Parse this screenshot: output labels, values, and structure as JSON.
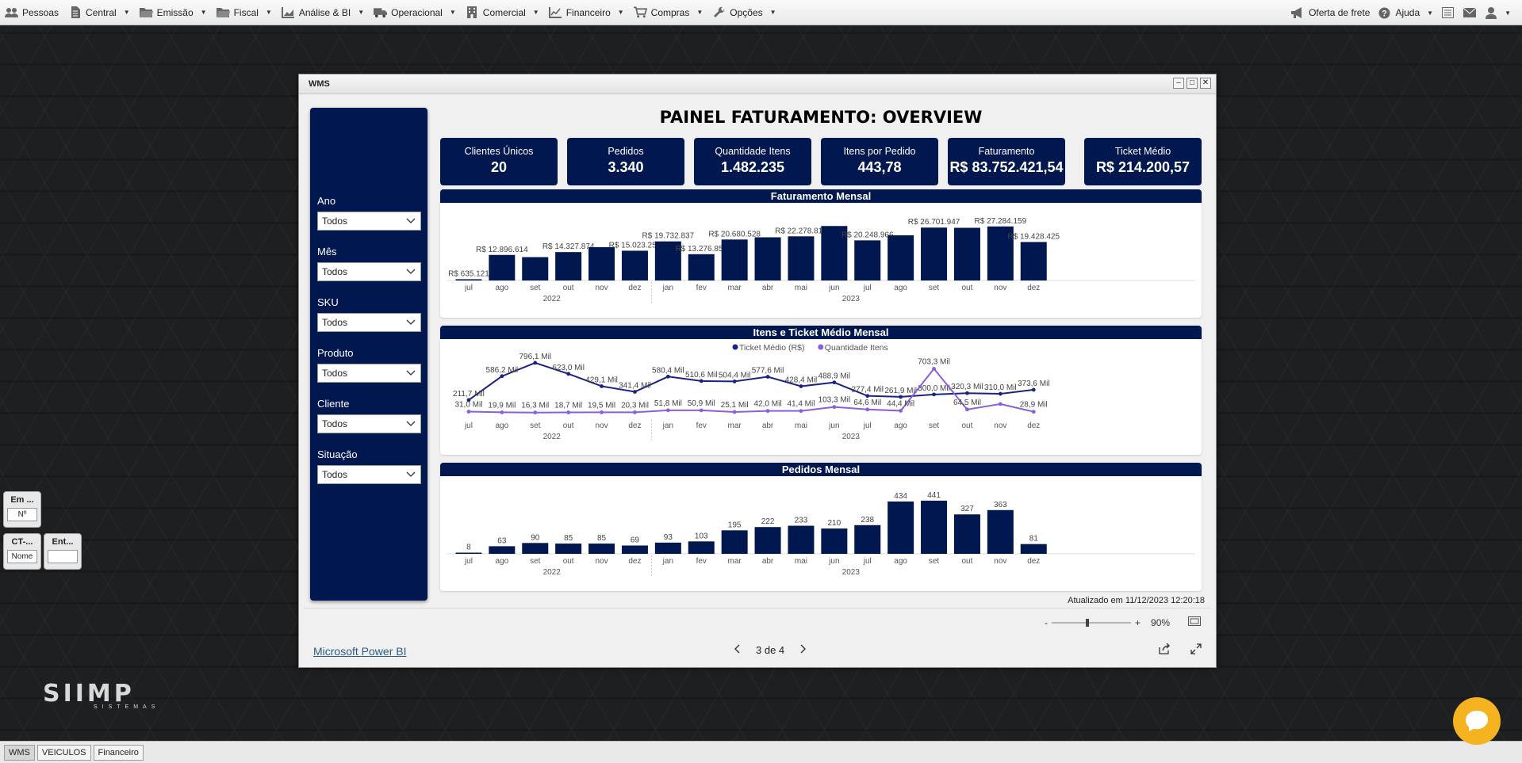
{
  "menu": {
    "items": [
      {
        "label": "Pessoas",
        "icon": "people-icon",
        "caret": false
      },
      {
        "label": "Central",
        "icon": "document-icon",
        "caret": true
      },
      {
        "label": "Emissão",
        "icon": "folder-icon",
        "caret": true
      },
      {
        "label": "Fiscal",
        "icon": "folder-icon",
        "caret": true
      },
      {
        "label": "Análise & BI",
        "icon": "chart-icon",
        "caret": true
      },
      {
        "label": "Operacional",
        "icon": "truck-icon",
        "caret": true
      },
      {
        "label": "Comercial",
        "icon": "building-icon",
        "caret": true
      },
      {
        "label": "Financeiro",
        "icon": "line-chart-icon",
        "caret": true
      },
      {
        "label": "Compras",
        "icon": "cart-icon",
        "caret": true
      },
      {
        "label": "Opções",
        "icon": "wrench-icon",
        "caret": true
      }
    ],
    "right": {
      "freight": "Oferta de frete",
      "help": "Ajuda"
    }
  },
  "side_buttons": {
    "em_title": "Em ...",
    "em_box": "Nº",
    "ct_title": "CT-...",
    "ct_box": "Nome",
    "ent_title": "Ent..."
  },
  "logo": {
    "main": "SIIMP",
    "sub": "SISTEMAS"
  },
  "taskbar": {
    "tabs": [
      "WMS",
      "VEICULOS",
      "Financeiro"
    ]
  },
  "window": {
    "title": "WMS"
  },
  "report": {
    "title": "PAINEL FATURAMENTO: OVERVIEW",
    "cards": [
      {
        "label": "Clientes Únicos",
        "value": "20"
      },
      {
        "label": "Pedidos",
        "value": "3.340"
      },
      {
        "label": "Quantidade Itens",
        "value": "1.482.235"
      },
      {
        "label": "Itens por Pedido",
        "value": "443,78"
      },
      {
        "label": "Faturamento",
        "value": "R$ 83.752.421,54"
      },
      {
        "label": "Ticket Médio",
        "value": "R$ 214.200,57"
      }
    ],
    "slicers": [
      {
        "label": "Ano",
        "value": "Todos"
      },
      {
        "label": "Mês",
        "value": "Todos"
      },
      {
        "label": "SKU",
        "value": "Todos"
      },
      {
        "label": "Produto",
        "value": "Todos"
      },
      {
        "label": "Cliente",
        "value": "Todos"
      },
      {
        "label": "Situação",
        "value": "Todos"
      }
    ],
    "updated": "Atualizado em 11/12/2023 12:20:18",
    "zoom": {
      "minus": "-",
      "plus": "+",
      "value": "90%",
      "level": 0.45
    },
    "footer": {
      "link": "Microsoft Power BI",
      "pages": "3 de 4"
    }
  },
  "chart_data": [
    {
      "type": "bar",
      "title": "Faturamento Mensal",
      "categories": [
        "jul",
        "ago",
        "set",
        "out",
        "nov",
        "dez",
        "jan",
        "fev",
        "mar",
        "abr",
        "mai",
        "jun",
        "jul",
        "ago",
        "set",
        "out",
        "nov",
        "dez"
      ],
      "years": [
        {
          "label": "2022",
          "span": 6
        },
        {
          "label": "2023",
          "span": 12
        }
      ],
      "values": [
        635121,
        12896614,
        11800000,
        14327874,
        16800000,
        15023255,
        19732837,
        13276855,
        20680528,
        21800000,
        22278813,
        27500000,
        20248966,
        22800000,
        26701947,
        26600000,
        27284159,
        19428425
      ],
      "data_labels": [
        "R$ 635.121",
        "R$ 12.896.614",
        "",
        "R$ 14.327.874",
        "",
        "R$ 15.023.255",
        "R$ 19.732.837",
        "R$ 13.276.855",
        "R$ 20.680.528",
        "",
        "R$ 22.278.813",
        "",
        "R$ 20.248.966",
        "",
        "R$ 26.701.947",
        "",
        "R$ 27.284.159",
        "R$ 19.428.425"
      ],
      "ylim": [
        0,
        28000000
      ]
    },
    {
      "type": "line",
      "title": "Itens e Ticket Médio Mensal",
      "categories": [
        "jul",
        "ago",
        "set",
        "out",
        "nov",
        "dez",
        "jan",
        "fev",
        "mar",
        "abr",
        "mai",
        "jun",
        "jul",
        "ago",
        "set",
        "out",
        "nov",
        "dez"
      ],
      "years": [
        {
          "label": "2022",
          "span": 6
        },
        {
          "label": "2023",
          "span": 12
        }
      ],
      "series": [
        {
          "name": "Ticket Médio (R$)",
          "color": "#1a237e",
          "values": [
            211.7,
            586.2,
            796.1,
            623.0,
            429.1,
            341.4,
            580.4,
            510.6,
            504.4,
            577.6,
            428.4,
            488.9,
            277.4,
            261.9,
            300.0,
            320.3,
            310.0,
            373.6
          ],
          "labels": [
            "211,7 Mil",
            "586,2 Mil",
            "796,1 Mil",
            "623,0 Mil",
            "429,1 Mil",
            "341,4 Mil",
            "580,4 Mil",
            "510,6 Mil",
            "504,4 Mil",
            "577,6 Mil",
            "428,4 Mil",
            "488,9 Mil",
            "277,4 Mil",
            "261,9 Mil",
            "300,0 Mil",
            "320,3 Mil",
            "310,0 Mil",
            "373,6 Mil"
          ]
        },
        {
          "name": "Quantidade Itens",
          "color": "#8b5fd8",
          "values": [
            31.0,
            19.9,
            16.3,
            18.7,
            19.5,
            20.3,
            51.8,
            50.9,
            25.1,
            42.0,
            41.4,
            103.3,
            64.6,
            44.4,
            703.3,
            64.5,
            150.0,
            28.9
          ],
          "labels": [
            "31,0 Mil",
            "19,9 Mil",
            "16,3 Mil",
            "18,7 Mil",
            "19,5 Mil",
            "20,3 Mil",
            "51,8 Mil",
            "50,9 Mil",
            "25,1 Mil",
            "42,0 Mil",
            "41,4 Mil",
            "103,3 Mil",
            "64,6 Mil",
            "44,4 Mil",
            "703,3 Mil",
            "64,5 Mil",
            "",
            "28,9 Mil"
          ]
        }
      ],
      "ylim": [
        0,
        820
      ]
    },
    {
      "type": "bar",
      "title": "Pedidos Mensal",
      "categories": [
        "jul",
        "ago",
        "set",
        "out",
        "nov",
        "dez",
        "jan",
        "fev",
        "mar",
        "abr",
        "mai",
        "jun",
        "jul",
        "ago",
        "set",
        "out",
        "nov",
        "dez"
      ],
      "years": [
        {
          "label": "2022",
          "span": 6
        },
        {
          "label": "2023",
          "span": 12
        }
      ],
      "values": [
        8,
        63,
        90,
        85,
        85,
        69,
        93,
        103,
        195,
        222,
        233,
        210,
        238,
        434,
        441,
        327,
        363,
        81
      ],
      "ylim": [
        0,
        460
      ]
    }
  ]
}
